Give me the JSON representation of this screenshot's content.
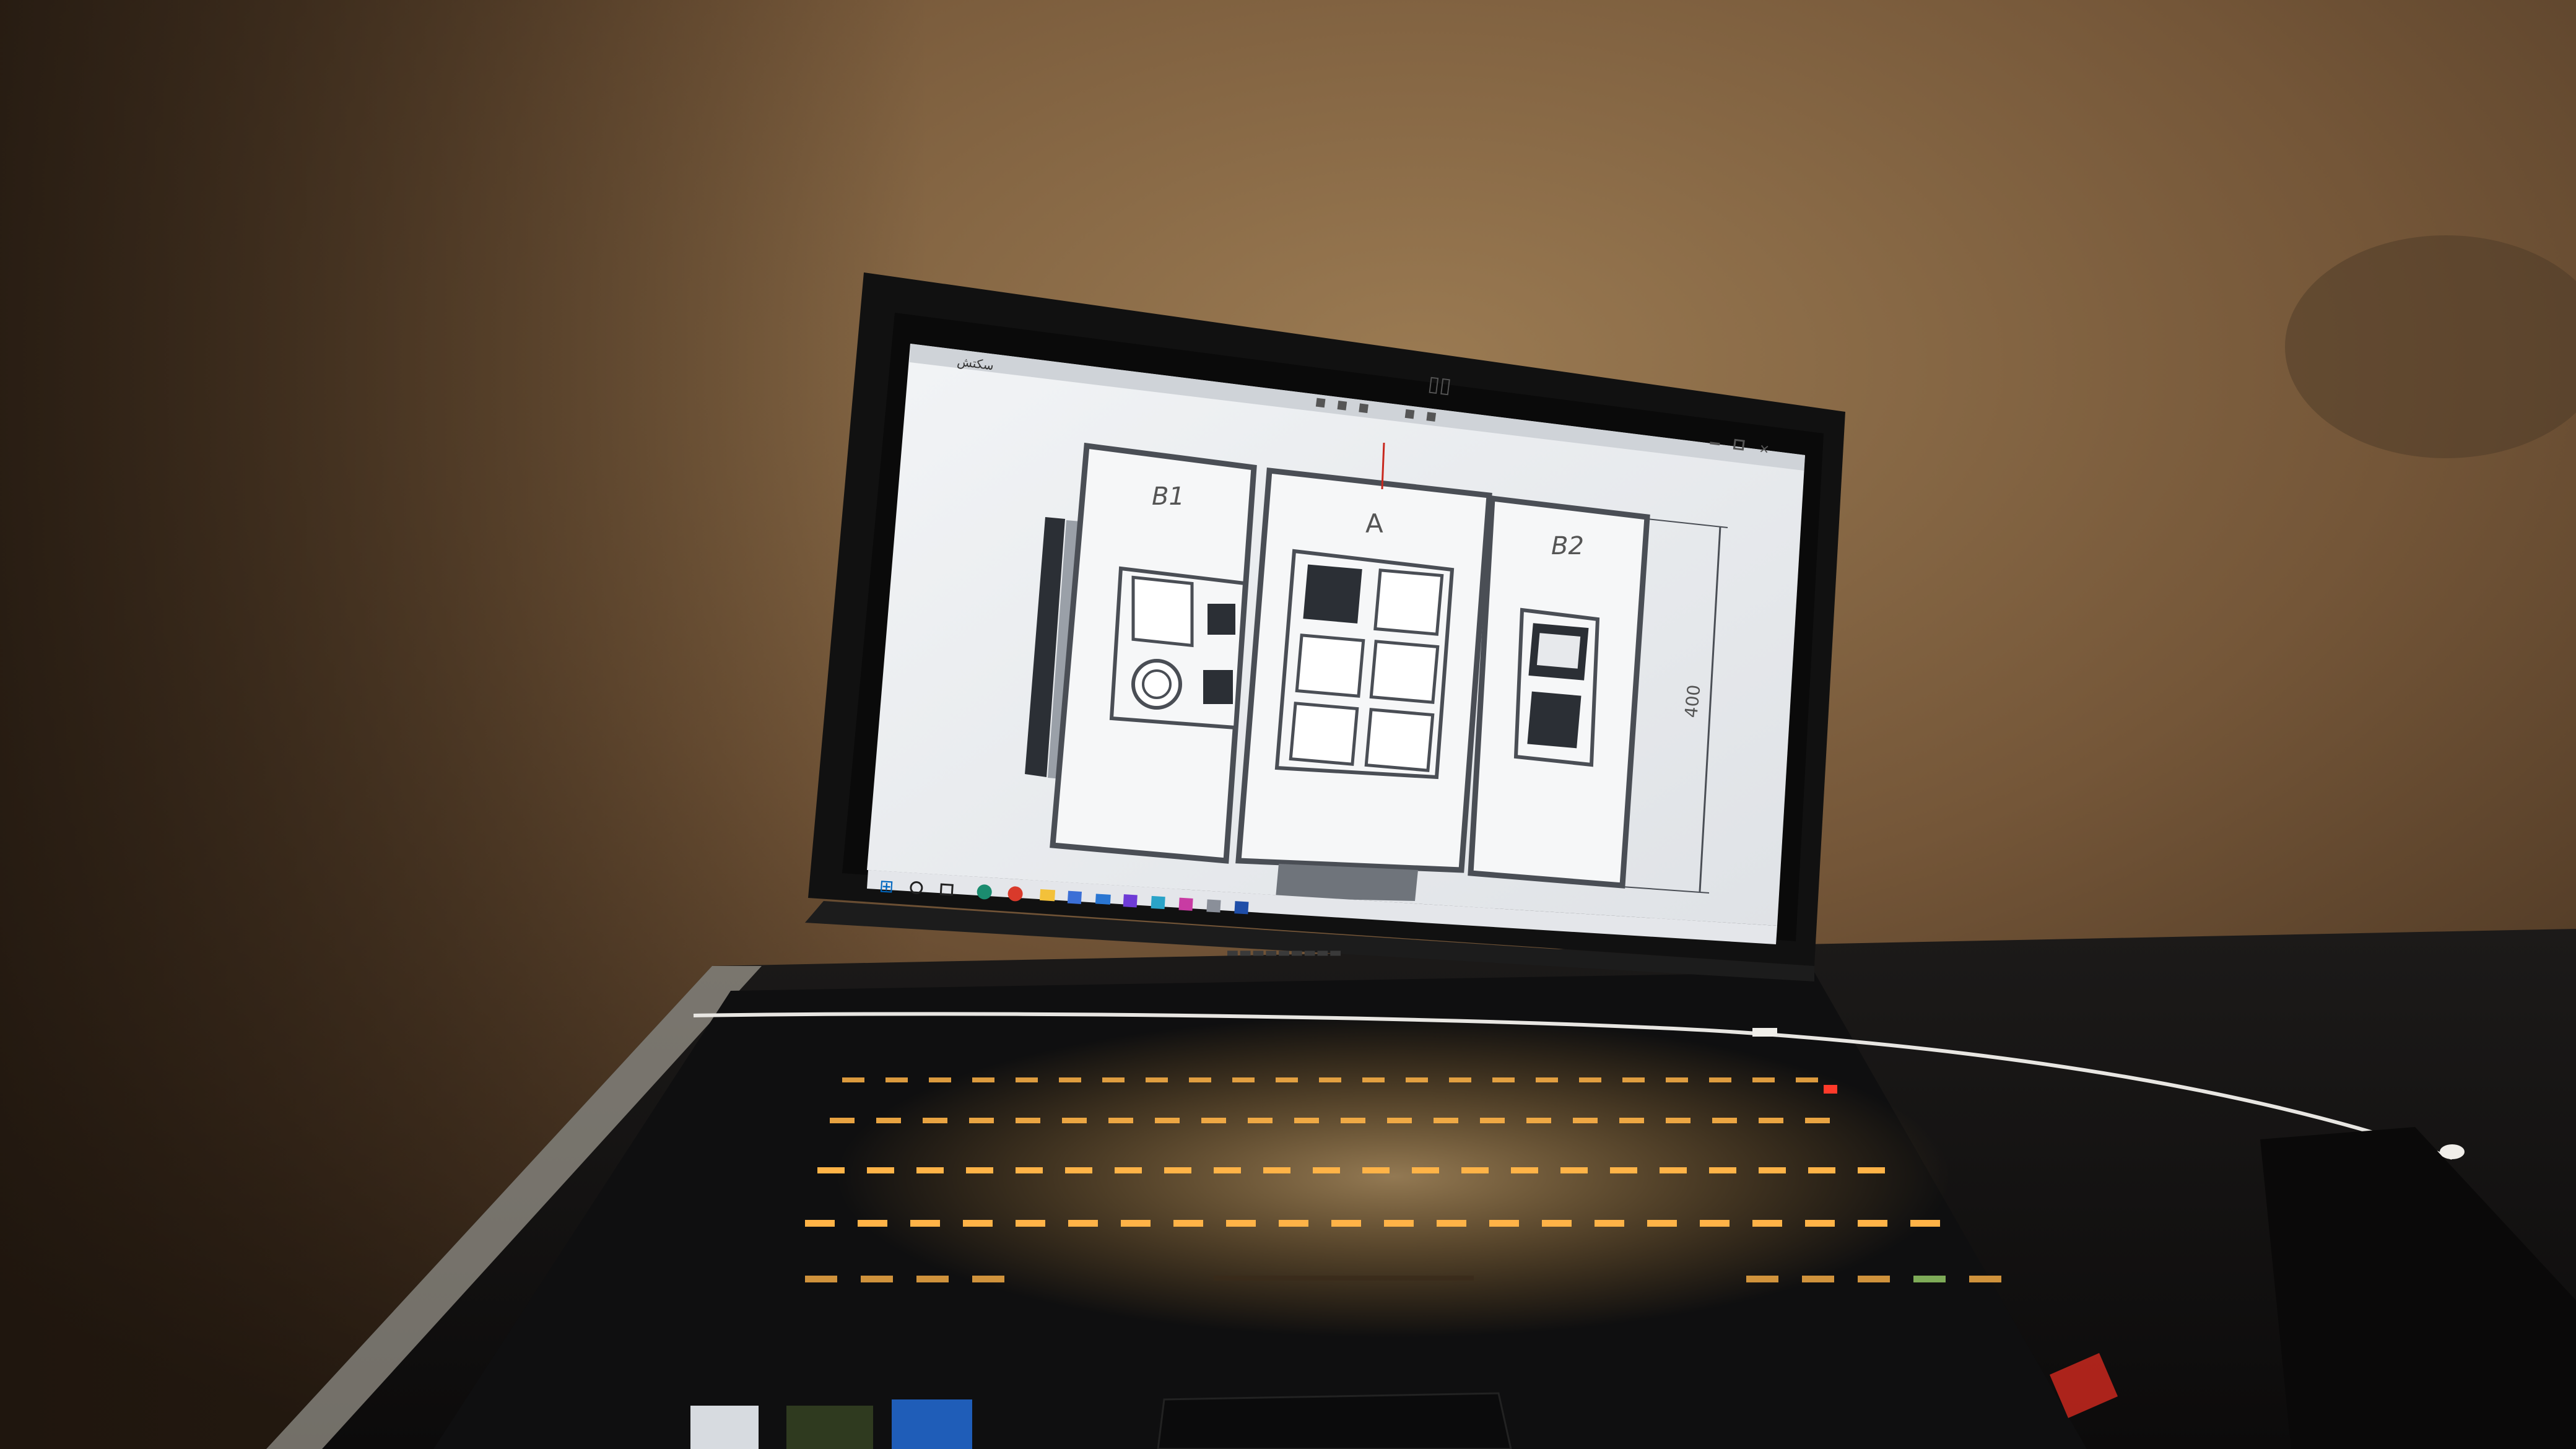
{
  "scene": {
    "wall_top_color": "#8a6a45",
    "wall_mid_color": "#6b4f33",
    "wall_dark_color": "#2a1e14",
    "desk_color": "#141212",
    "laptop_body_color": "#121212",
    "screen_bg_color": "#eceef0",
    "keyboard_glow_color": "#ffb347",
    "keyboard_hot_color": "#ff6a3a"
  },
  "app": {
    "title": "سكتش",
    "taskbar_icons": [
      "start-icon",
      "search-icon",
      "task-view-icon",
      "edge-icon",
      "chrome-icon",
      "folder-icon",
      "store-icon",
      "mail-icon",
      "app-icon-1",
      "app-icon-2",
      "app-icon-3",
      "app-icon-4",
      "app-icon-5"
    ]
  },
  "drawing": {
    "panel_b1_label": "B1",
    "panel_a_label": "A",
    "panel_b2_label": "B2",
    "dimension_label": "400",
    "line_color": "#4a4e55",
    "fill_dark": "#2b2f35",
    "panel_fill": "#f6f7f8"
  },
  "colors": {
    "accent_red": "#c8281e",
    "cable": "#e8e6e2"
  }
}
